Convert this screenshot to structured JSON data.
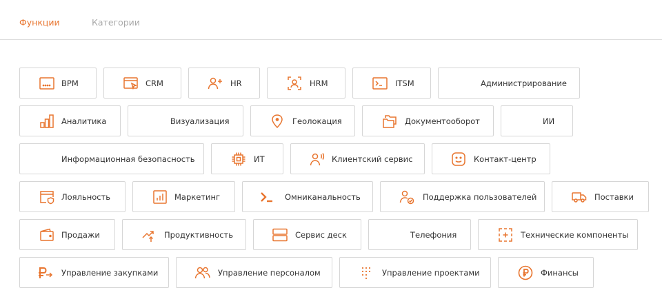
{
  "accent_color": "#e8752f",
  "tabs": {
    "functions": "Функции",
    "categories": "Категории"
  },
  "chips": [
    {
      "label": "BPM",
      "icon": "dots-window-icon"
    },
    {
      "label": "CRM",
      "icon": "browser-cursor-icon"
    },
    {
      "label": "HR",
      "icon": "user-add-icon"
    },
    {
      "label": "HRM",
      "icon": "user-focus-icon"
    },
    {
      "label": "ITSM",
      "icon": "terminal-box-icon"
    },
    {
      "label": "Администрирование",
      "icon": ""
    },
    {
      "label": "Аналитика",
      "icon": "bar-chart-icon"
    },
    {
      "label": "Визуализация",
      "icon": ""
    },
    {
      "label": "Геолокация",
      "icon": "map-pin-icon"
    },
    {
      "label": "Документооборот",
      "icon": "folders-icon"
    },
    {
      "label": "ИИ",
      "icon": ""
    },
    {
      "label": "Информационная безопасность",
      "icon": ""
    },
    {
      "label": "ИТ",
      "icon": "chip-icon"
    },
    {
      "label": "Клиентский сервис",
      "icon": "user-voice-icon"
    },
    {
      "label": "Контакт-центр",
      "icon": "smile-icon"
    },
    {
      "label": "Лояльность",
      "icon": "browser-shield-icon"
    },
    {
      "label": "Маркетинг",
      "icon": "chart-box-icon"
    },
    {
      "label": "Омниканальность",
      "icon": "terminal-prompt-icon"
    },
    {
      "label": "Поддержка пользователей",
      "icon": "user-check-icon"
    },
    {
      "label": "Поставки",
      "icon": "truck-icon"
    },
    {
      "label": "Продажи",
      "icon": "wallet-icon"
    },
    {
      "label": "Продуктивность",
      "icon": "trend-up-icon"
    },
    {
      "label": "Сервис деск",
      "icon": "server-icon"
    },
    {
      "label": "Телефония",
      "icon": ""
    },
    {
      "label": "Технические компоненты",
      "icon": "dashed-plus-icon"
    },
    {
      "label": "Управление закупками",
      "icon": "ruble-arrow-icon"
    },
    {
      "label": "Управление персоналом",
      "icon": "users-icon"
    },
    {
      "label": "Управление проектами",
      "icon": "dot-grid-icon"
    },
    {
      "label": "Финансы",
      "icon": "ruble-coin-icon"
    }
  ]
}
